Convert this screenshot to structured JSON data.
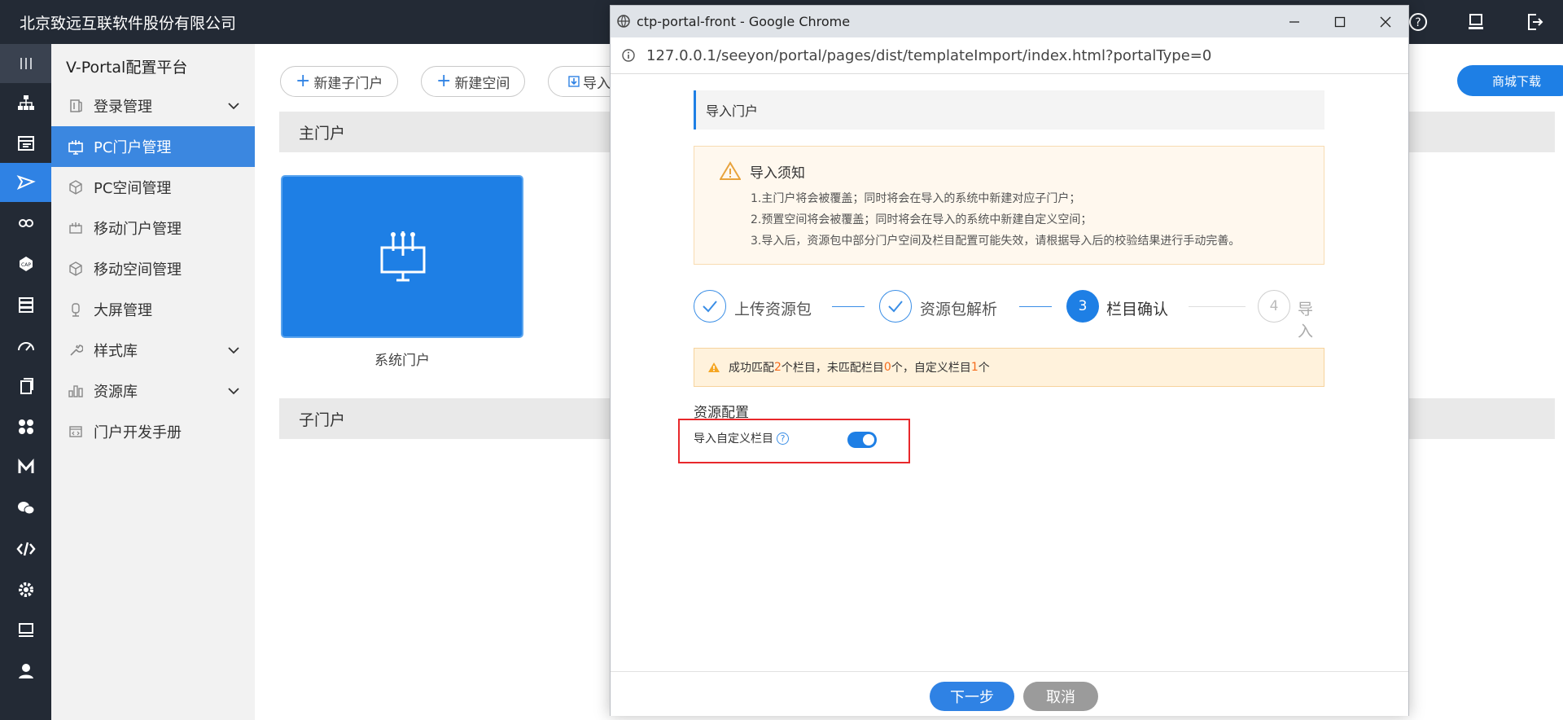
{
  "app": {
    "company": "北京致远互联软件股份有限公司"
  },
  "top_icons": [
    "help-icon",
    "monitor-icon",
    "logout-icon"
  ],
  "rail": [
    "menu-toggle-icon",
    "org-icon",
    "table-icon",
    "send-icon",
    "link-icon",
    "cap-icon",
    "storage-icon",
    "dashboard-icon",
    "document-icon",
    "apps-icon",
    "m-icon",
    "chat-icon",
    "code-icon",
    "settings-icon",
    "computer-icon",
    "user-icon"
  ],
  "sidebar": {
    "title": "V-Portal配置平台",
    "items": [
      {
        "label": "登录管理",
        "icon": "login-icon",
        "expandable": true
      },
      {
        "label": "PC门户管理",
        "icon": "pc-portal-icon",
        "active": true
      },
      {
        "label": "PC空间管理",
        "icon": "cube-icon"
      },
      {
        "label": "移动门户管理",
        "icon": "mobile-portal-icon"
      },
      {
        "label": "移动空间管理",
        "icon": "cube-icon"
      },
      {
        "label": "大屏管理",
        "icon": "screen-icon"
      },
      {
        "label": "样式库",
        "icon": "wrench-icon",
        "expandable": true
      },
      {
        "label": "资源库",
        "icon": "bars-icon",
        "expandable": true
      },
      {
        "label": "门户开发手册",
        "icon": "manual-icon"
      }
    ]
  },
  "toolbar": {
    "new_sub_portal": "新建子门户",
    "new_space": "新建空间",
    "import": "导入",
    "mall_download": "商城下载"
  },
  "sections": {
    "main_portal": "主门户",
    "sub_portal": "子门户"
  },
  "portal_card": {
    "label": "系统门户",
    "icon": "portal-icon"
  },
  "browser": {
    "title": "ctp-portal-front - Google Chrome",
    "url": "127.0.0.1/seeyon/portal/pages/dist/templateImport/index.html?portalType=0"
  },
  "dialog": {
    "title": "导入门户",
    "notice": {
      "title": "导入须知",
      "lines": [
        "1.主门户将会被覆盖；同时将会在导入的系统中新建对应子门户；",
        "2.预置空间将会被覆盖；同时将会在导入的系统中新建自定义空间；",
        "3.导入后，资源包中部分门户空间及栏目配置可能失效，请根据导入后的校验结果进行手动完善。"
      ]
    },
    "steps": [
      {
        "label": "上传资源包",
        "state": "done"
      },
      {
        "label": "资源包解析",
        "state": "done"
      },
      {
        "number": "3",
        "label": "栏目确认",
        "state": "active"
      },
      {
        "number": "4",
        "label": "导入",
        "state": "pending"
      }
    ],
    "match": {
      "p1": "成功匹配",
      "n1": "2",
      "p2": "个栏目，未匹配栏目",
      "n2": "0",
      "p3": "个，自定义栏目",
      "n3": "1",
      "p4": "个"
    },
    "resource_title": "资源配置",
    "import_custom_label": "导入自定义栏目",
    "help_glyph": "?",
    "toggle_on": true,
    "next_button": "下一步",
    "cancel_button": "取消"
  },
  "colors": {
    "accent": "#1e7fe5",
    "sidebar_dark": "#232a35",
    "warning": "#f5a623",
    "highlight_box": "#e8282b"
  }
}
